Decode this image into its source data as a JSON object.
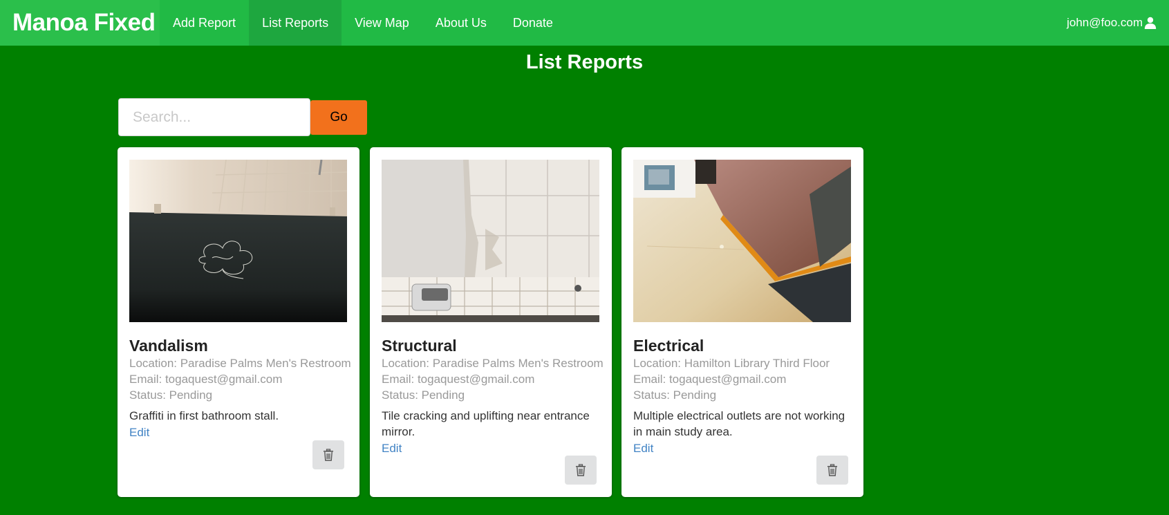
{
  "navbar": {
    "brand": "Manoa Fixed",
    "items": [
      {
        "label": "Add Report"
      },
      {
        "label": "List Reports"
      },
      {
        "label": "View Map"
      },
      {
        "label": "About Us"
      },
      {
        "label": "Donate"
      }
    ],
    "user_email": "john@foo.com",
    "user_icon": "user-icon"
  },
  "page": {
    "title": "List Reports"
  },
  "search": {
    "placeholder": "Search...",
    "value": "",
    "button_label": "Go"
  },
  "reports": [
    {
      "category": "Vandalism",
      "location": "Location: Paradise Palms Men's Restroom",
      "email": "Email: togaquest@gmail.com",
      "status": "Status: Pending",
      "description": "Graffiti in first bathroom stall.",
      "edit_label": "Edit"
    },
    {
      "category": "Structural",
      "location": "Location: Paradise Palms Men's Restroom",
      "email": "Email: togaquest@gmail.com",
      "status": "Status: Pending",
      "description": "Tile cracking and uplifting near entrance mirror.",
      "edit_label": "Edit"
    },
    {
      "category": "Electrical",
      "location": "Location: Hamilton Library Third Floor",
      "email": "Email: togaquest@gmail.com",
      "status": "Status: Pending",
      "description": "Multiple electrical outlets are not working in main study area.",
      "edit_label": "Edit"
    }
  ],
  "colors": {
    "page_background": "#008000",
    "navbar": "#21ba45",
    "go_button": "#f2711c",
    "link": "#4183c4"
  }
}
